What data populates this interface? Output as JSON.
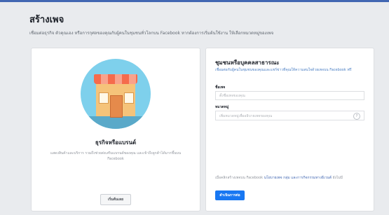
{
  "page": {
    "title": "สร้างเพจ",
    "subtitle": "เชื่อมต่อธุรกิจ ตัวคุณเอง หรือการกุศลของคุณกับผู้คนในชุมชนทั่วโลกบน Facebook หากต้องการเริ่มต้นใช้งาน ให้เลือกหมวดหมู่ของเพจ"
  },
  "business": {
    "title": "ธุรกิจหรือแบรนด์",
    "description": "แสดงสินค้าและบริการ รวมถึงช่วยส่งเสริมแบรนด์ของคุณ และเข้าถึงลูกค้าได้มากขึ้นบน Facebook",
    "button_label": "เริ่มต้นเลย"
  },
  "community": {
    "title": "ชุมชนหรือบุคคลสาธารณะ",
    "description": "เชื่อมต่อกับผู้คนในชุมชนของคุณและแชร์ข่าวที่คุณให้ความสนใจด้วยเพจบน Facebook ฟรี",
    "name_label": "ชื่อเพจ",
    "name_placeholder": "ตั้งชื่อเพจของคุณ",
    "category_label": "หมวดหมู่",
    "category_placeholder": "เพิ่มหมวดหมู่เพื่ออธิบายเพจของคุณ",
    "terms_text": "เมื่อคลิกสร้างเพจบน Facebook",
    "terms_links": "นโยบายเพจ กลุ่ม และการกิจกรรมทางอีเวนต์",
    "terms_suffix": "ยังไม่มี",
    "button_label": "ดำเนินการต่อ"
  }
}
